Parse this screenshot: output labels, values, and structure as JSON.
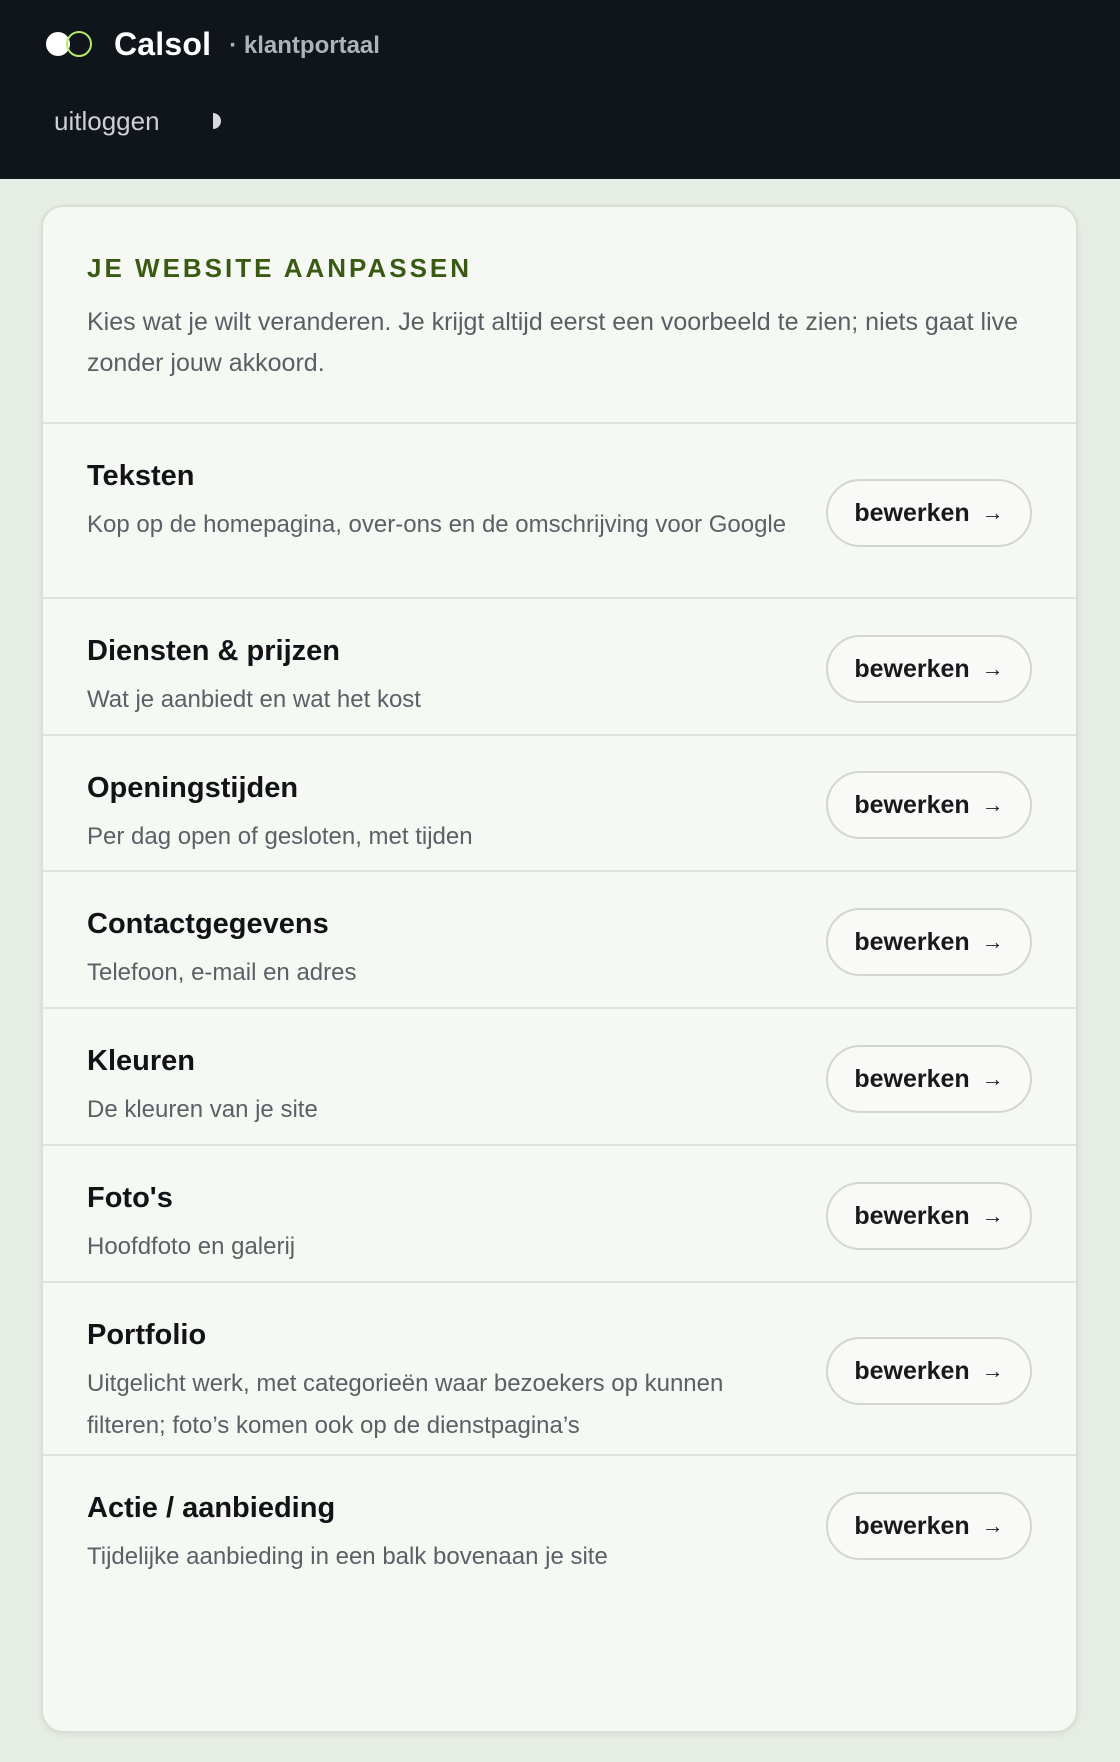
{
  "header": {
    "brand_name": "Calsol",
    "brand_sub": "· klantportaal",
    "logout_label": "uitloggen"
  },
  "card": {
    "title": "JE WEBSITE AANPASSEN",
    "intro": "Kies wat je wilt veranderen. Je krijgt altijd eerst een voorbeeld te zien; niets gaat live zonder jouw akkoord.",
    "items": [
      {
        "title": "Teksten",
        "description": "Kop op de homepagina, over-ons en de omschrijving voor Google",
        "button": "bewerken",
        "arrow": "→"
      },
      {
        "title": "Diensten & prijzen",
        "description": "Wat je aanbiedt en wat het kost",
        "button": "bewerken",
        "arrow": "→"
      },
      {
        "title": "Openingstijden",
        "description": "Per dag open of gesloten, met tijden",
        "button": "bewerken",
        "arrow": "→"
      },
      {
        "title": "Contactgegevens",
        "description": "Telefoon, e-mail en adres",
        "button": "bewerken",
        "arrow": "→"
      },
      {
        "title": "Kleuren",
        "description": "De kleuren van je site",
        "button": "bewerken",
        "arrow": "→"
      },
      {
        "title": "Foto's",
        "description": "Hoofdfoto en galerij",
        "button": "bewerken",
        "arrow": "→"
      },
      {
        "title": "Portfolio",
        "description": "Uitgelicht werk, met categorieën waar bezoekers op kunnen filteren; foto’s komen ook op de dienstpagina’s",
        "button": "bewerken",
        "arrow": "→"
      },
      {
        "title": "Actie / aanbieding",
        "description": "Tijdelijke aanbieding in een balk bovenaan je site",
        "button": "bewerken",
        "arrow": "→"
      }
    ]
  },
  "colors": {
    "topbar": "#10141b",
    "page_background": "#e6ede4",
    "card_background": "#f6f8f4",
    "accent_title": "#3a5a14",
    "logo_ring": "#b6e86e"
  },
  "icons": {
    "logo": "two-circles-logo-icon",
    "theme": "half-moon-icon",
    "button_arrow": "arrow-right-icon"
  }
}
